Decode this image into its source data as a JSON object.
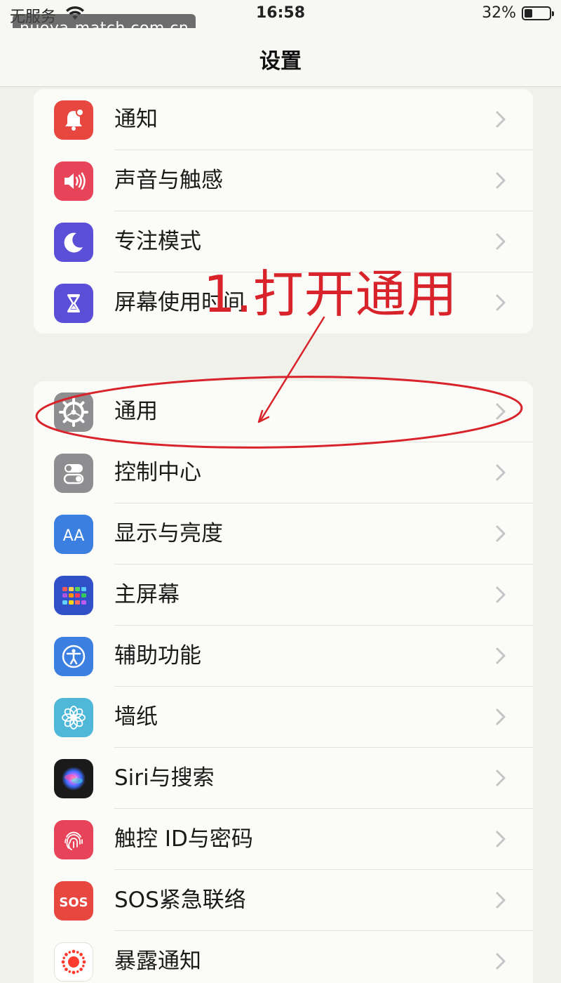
{
  "status_bar": {
    "carrier": "无服务",
    "time": "16:58",
    "battery_percent": "32%",
    "battery_level": 0.32
  },
  "watermark": "nuoya-match.com.cn",
  "nav": {
    "title": "设置"
  },
  "group1": [
    {
      "label": "通知",
      "icon": "notification-bell-icon",
      "color": "#e8473f"
    },
    {
      "label": "声音与触感",
      "icon": "speaker-icon",
      "color": "#e84459"
    },
    {
      "label": "专注模式",
      "icon": "moon-icon",
      "color": "#5b4fd8"
    },
    {
      "label": "屏幕使用时间",
      "icon": "hourglass-icon",
      "color": "#5b4fd8"
    }
  ],
  "group2": [
    {
      "label": "通用",
      "icon": "gear-icon",
      "color": "#8e8e90"
    },
    {
      "label": "控制中心",
      "icon": "toggles-icon",
      "color": "#8e8e90"
    },
    {
      "label": "显示与亮度",
      "icon": "text-size-icon",
      "color": "#3b7fe0"
    },
    {
      "label": "主屏幕",
      "icon": "home-grid-icon",
      "color": "#3050c8"
    },
    {
      "label": "辅助功能",
      "icon": "accessibility-icon",
      "color": "#3b7fe0"
    },
    {
      "label": "墙纸",
      "icon": "flower-icon",
      "color": "#4fb8d8"
    },
    {
      "label": "Siri与搜索",
      "icon": "siri-icon",
      "color": "#222"
    },
    {
      "label": "触控 ID与密码",
      "icon": "fingerprint-icon",
      "color": "#e84459"
    },
    {
      "label": "SOS紧急联络",
      "icon": "sos-icon",
      "color": "#e8473f"
    },
    {
      "label": "暴露通知",
      "icon": "exposure-icon",
      "color": "#ffffff"
    }
  ],
  "annotation": {
    "text": "1.打开通用",
    "color": "#d8232a"
  }
}
